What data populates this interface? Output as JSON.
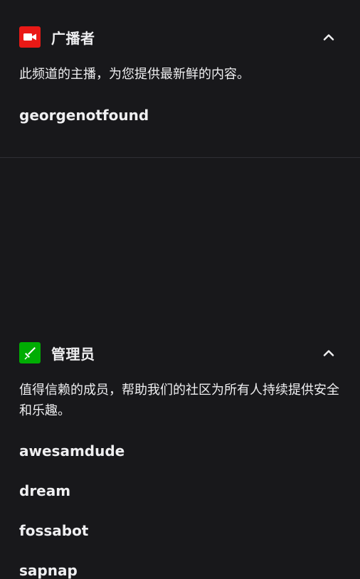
{
  "broadcaster": {
    "title": "广播者",
    "icon": "video-camera-icon",
    "badge_color": "#e91916",
    "description": "此频道的主播，为您提供最新鲜的内容。",
    "users": [
      "georgenotfound"
    ]
  },
  "moderators": {
    "title": "管理员",
    "icon": "sword-icon",
    "badge_color": "#00ad03",
    "description": "值得信赖的成员，帮助我们的社区为所有人持续提供安全和乐趣。",
    "users": [
      "awesamdude",
      "dream",
      "fossabot",
      "sapnap"
    ]
  }
}
